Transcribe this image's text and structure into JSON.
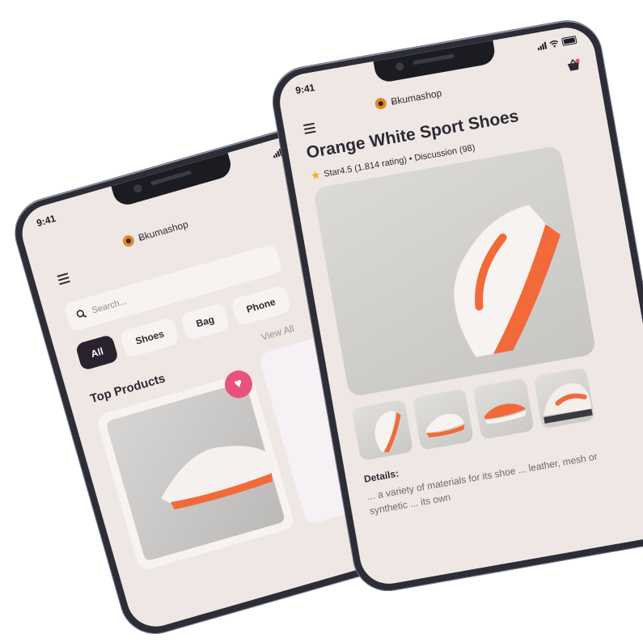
{
  "left_phone": {
    "status_time": "9:41",
    "brand": "ƁkumashopIcon",
    "brand_name": "Ƀkumashop",
    "search_placeholder": "Search...",
    "categories": [
      "All",
      "Shoes",
      "Bag",
      "Phone"
    ],
    "active_category": "All",
    "section_title": "Top Products",
    "view_all": "View All"
  },
  "right_phone": {
    "status_time": "9:41",
    "brand_name": "Ƀkumashop",
    "product_title": "Orange White Sport  Shoes",
    "rating_text": "Star4.5 (1.814 rating) • Discussion (98)",
    "details_label": "Details:",
    "details_text": "... a variety of materials for its shoe ... leather, mesh or synthetic ... its own"
  },
  "colors": {
    "accent_dark": "#2b2230",
    "heart": "#e8537b",
    "shoe_orange": "#f26a3a",
    "star": "#f2b018"
  }
}
